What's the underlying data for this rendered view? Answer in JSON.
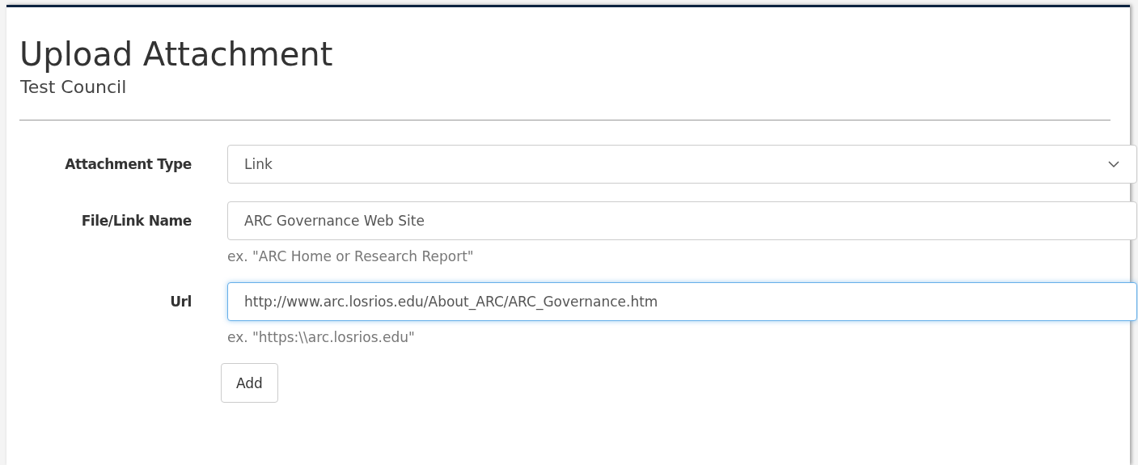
{
  "title": "Upload Attachment",
  "subtitle": "Test Council",
  "fields": [
    {
      "kind": "select",
      "label": "Attachment Type",
      "value": "Link",
      "focused": false
    },
    {
      "kind": "text",
      "label": "File/Link Name",
      "value": "ARC Governance Web Site",
      "help": "ex. \"ARC Home or Research Report\"",
      "focused": false
    },
    {
      "kind": "text",
      "label": "Url",
      "value": "http://www.arc.losrios.edu/About_ARC/ARC_Governance.htm",
      "help": "ex. \"https:\\\\arc.losrios.edu\"",
      "focused": true
    }
  ],
  "buttons": [
    "Add"
  ]
}
